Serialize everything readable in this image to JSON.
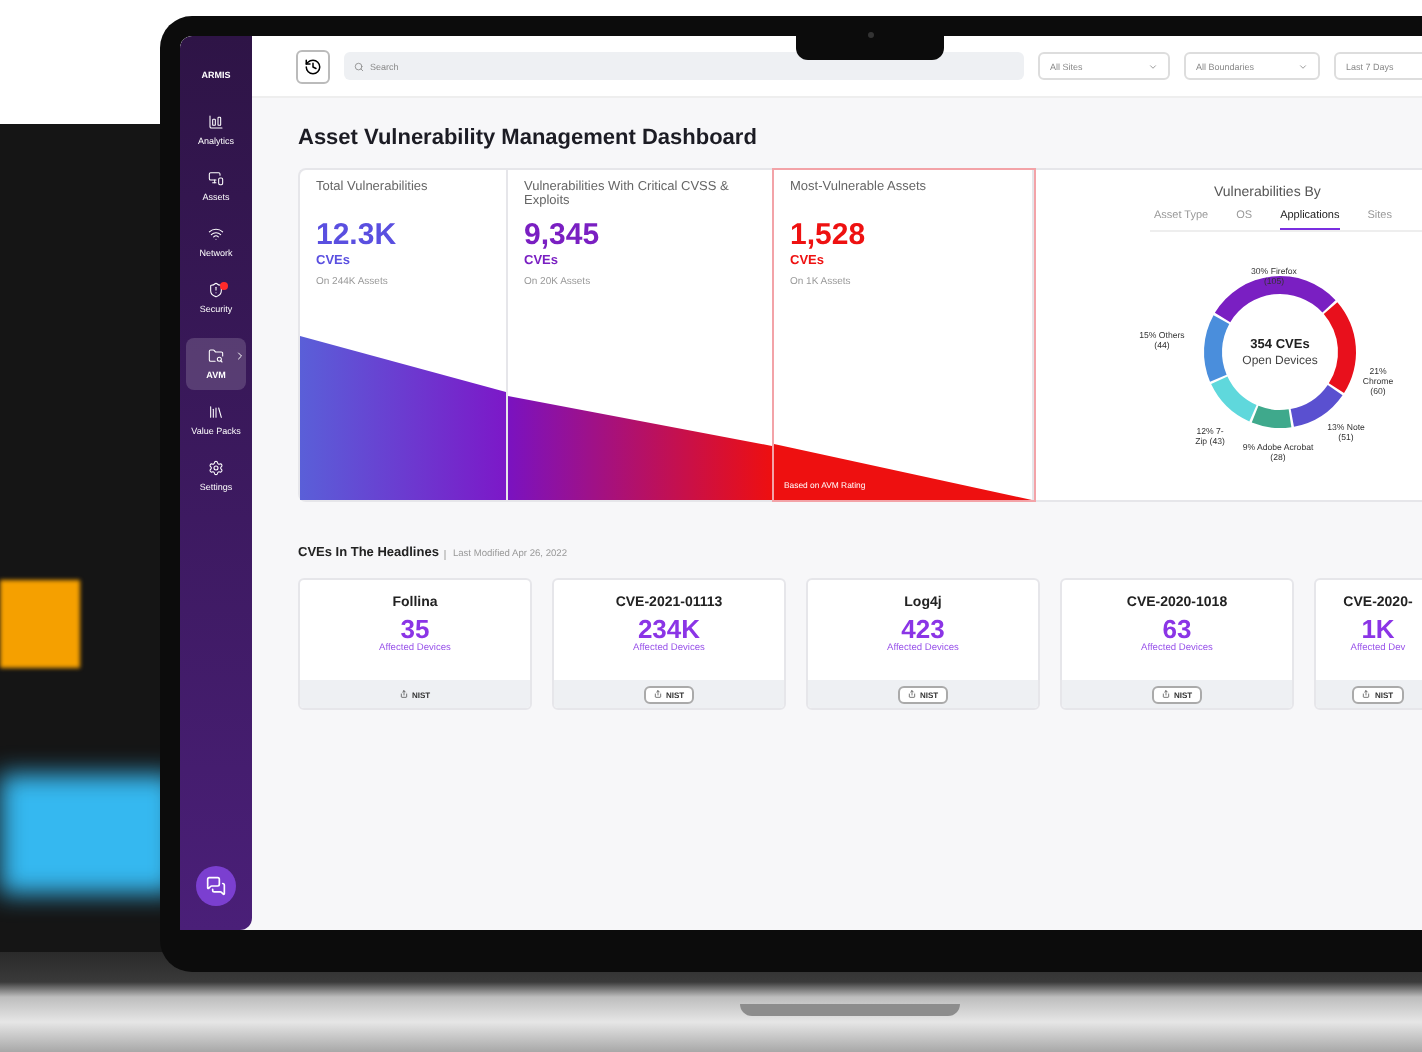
{
  "sidebar": {
    "logo": "ARMIS",
    "items": [
      {
        "label": "Analytics",
        "selected": false,
        "alert": false
      },
      {
        "label": "Assets",
        "selected": false,
        "alert": false
      },
      {
        "label": "Network",
        "selected": false,
        "alert": false
      },
      {
        "label": "Security",
        "selected": false,
        "alert": true
      },
      {
        "label": "AVM",
        "selected": true,
        "alert": false
      },
      {
        "label": "Value Packs",
        "selected": false,
        "alert": false
      },
      {
        "label": "Settings",
        "selected": false,
        "alert": false
      }
    ]
  },
  "topbar": {
    "search": {
      "placeholder": "Search"
    },
    "filters": [
      "All Sites",
      "All Boundaries",
      "Last 7 Days"
    ]
  },
  "title": "Asset Vulnerability Management Dashboard",
  "stats": [
    {
      "title": "Total Vulnerabilities",
      "value": "12.3K",
      "unit": "CVEs",
      "assets": "On 244K Assets",
      "color": "#5a4fe0"
    },
    {
      "title": "Vulnerabilities With Critical CVSS & Exploits",
      "value": "9,345",
      "unit": "CVEs",
      "assets": "On 20K Assets",
      "color": "#7a1fc2"
    },
    {
      "title": "Most-Vulnerable Assets",
      "value": "1,528",
      "unit": "CVEs",
      "assets": "On 1K Assets",
      "color": "#ee1111",
      "note": "Based on AVM Rating"
    }
  ],
  "breakdown": {
    "title": "Vulnerabilities By",
    "tabs": [
      {
        "label": "Asset Type",
        "selected": false
      },
      {
        "label": "OS",
        "selected": false
      },
      {
        "label": "Applications",
        "selected": true
      },
      {
        "label": "Sites",
        "selected": false
      }
    ],
    "center": {
      "value": "354 CVEs",
      "caption": "Open Devices"
    },
    "chart_data": {
      "type": "donut",
      "categories": [
        "Firefox (105)",
        "Chrome (60)",
        "Note (51)",
        "Adobe Acrobat (28)",
        "7-Zip (43)",
        "Others (44)"
      ],
      "values": [
        30,
        21,
        13,
        9,
        12,
        15
      ],
      "value_labels": [
        "30%",
        "21%",
        "13%",
        "9%",
        "12%",
        "15%"
      ],
      "colors": [
        "#7a1fc2",
        "#e8101c",
        "#5a50d0",
        "#3fa98c",
        "#5fd8dc",
        "#4a8edc"
      ]
    }
  },
  "headlines": {
    "title": "CVEs In The Headlines",
    "modified": "Last Modified Apr 26, 2022",
    "cards": [
      {
        "name": "Follina",
        "value": "35",
        "label": "Affected Devices",
        "link": "NIST",
        "framed": false
      },
      {
        "name": "CVE-2021-01113",
        "value": "234K",
        "label": "Affected Devices",
        "link": "NIST",
        "framed": true
      },
      {
        "name": "Log4j",
        "value": "423",
        "label": "Affected Devices",
        "link": "NIST",
        "framed": true
      },
      {
        "name": "CVE-2020-1018",
        "value": "63",
        "label": "Affected Devices",
        "link": "NIST",
        "framed": true
      },
      {
        "name": "CVE-2020-",
        "value": "1K",
        "label": "Affected Dev",
        "link": "NIST",
        "framed": true
      }
    ]
  }
}
